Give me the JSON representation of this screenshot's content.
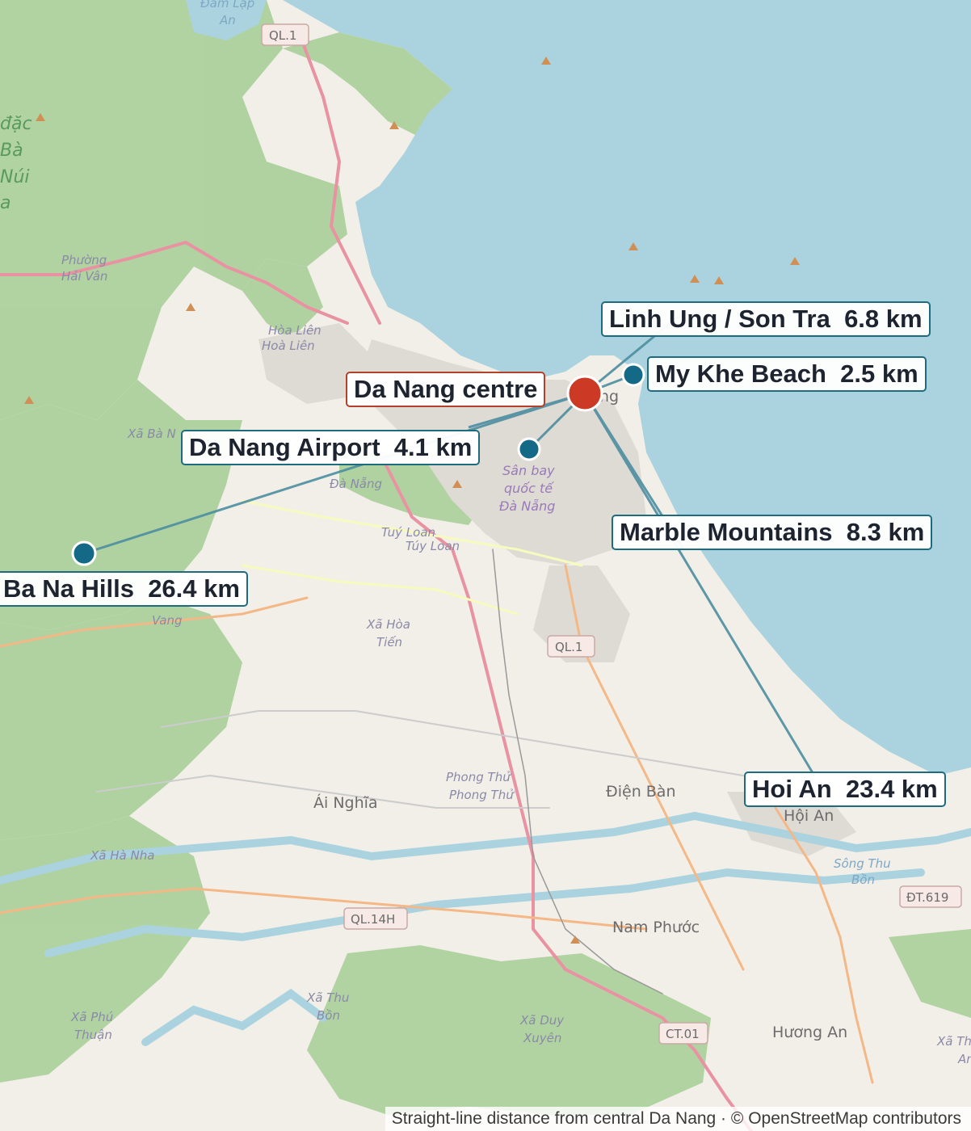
{
  "centre": {
    "label": "Da Nang centre",
    "color": "#cc3a25"
  },
  "marker_color": "#146a86",
  "leader_color": "#4d8ea0",
  "destinations": [
    {
      "name": "Linh Ung / Son Tra",
      "distance": "6.8 km"
    },
    {
      "name": "My Khe Beach",
      "distance": "2.5 km"
    },
    {
      "name": "Da Nang Airport",
      "distance": "4.1 km"
    },
    {
      "name": "Marble Mountains",
      "distance": "8.3 km"
    },
    {
      "name": "Ba Na Hills",
      "distance": "26.4 km"
    },
    {
      "name": "Hoi An",
      "distance": "23.4 km"
    }
  ],
  "footer": "Straight-line distance from central Da Nang · © OpenStreetMap contributors",
  "basemap_labels": {
    "dam_lap": "Đầm Lập",
    "an": "An",
    "dac": "đặc",
    "ba": "Bà",
    "nui": "Núi",
    "a": "a",
    "phuong_hai_van_1": "Phường",
    "phuong_hai_van_2": "Hải Vân",
    "hoa_lien_1": "Hòa Liên",
    "hoa_lien_2": "Hoà Liên",
    "xa_ba_na": "Xã Bà N",
    "da_nang_partial": "ng",
    "san_bay_1": "Sân bay",
    "san_bay_2": "quốc tế",
    "san_bay_3": "Đà Nẵng",
    "da_nang_lbl": "Đà Nẵng",
    "tuy_loan_1": "Tuý Loan",
    "tuy_loan_2": "Túy Loan",
    "vang": "Vang",
    "xa_hoa_tien_1": "Xã Hòa",
    "xa_hoa_tien_2": "Tiến",
    "phong_thu_1": "Phong Thử",
    "phong_thu_2": "Phong Thử",
    "ai_nghia": "Ái Nghĩa",
    "dien_ban": "Điện Bàn",
    "hoi_an": "Hội An",
    "song_thu_bon_1": "Sông Thu",
    "song_thu_bon_2": "Bồn",
    "xa_ha_nha": "Xã Hà Nha",
    "nam_phuoc": "Nam Phước",
    "xa_thu_bon_1": "Xã Thu",
    "xa_thu_bon_2": "Bồn",
    "xa_phu_thuan_1": "Xã Phú",
    "xa_phu_thuan_2": "Thuận",
    "xa_duy_xuyen_1": "Xã Duy",
    "xa_duy_xuyen_2": "Xuyên",
    "huong_an": "Hương An",
    "xa_th_1": "Xã Th",
    "xa_th_2": "An"
  },
  "road_shields": {
    "ql1_north": "QL.1",
    "ql1_south": "QL.1",
    "ql14h": "QL.14H",
    "dt619": "ĐT.619",
    "ct01": "CT.01"
  }
}
